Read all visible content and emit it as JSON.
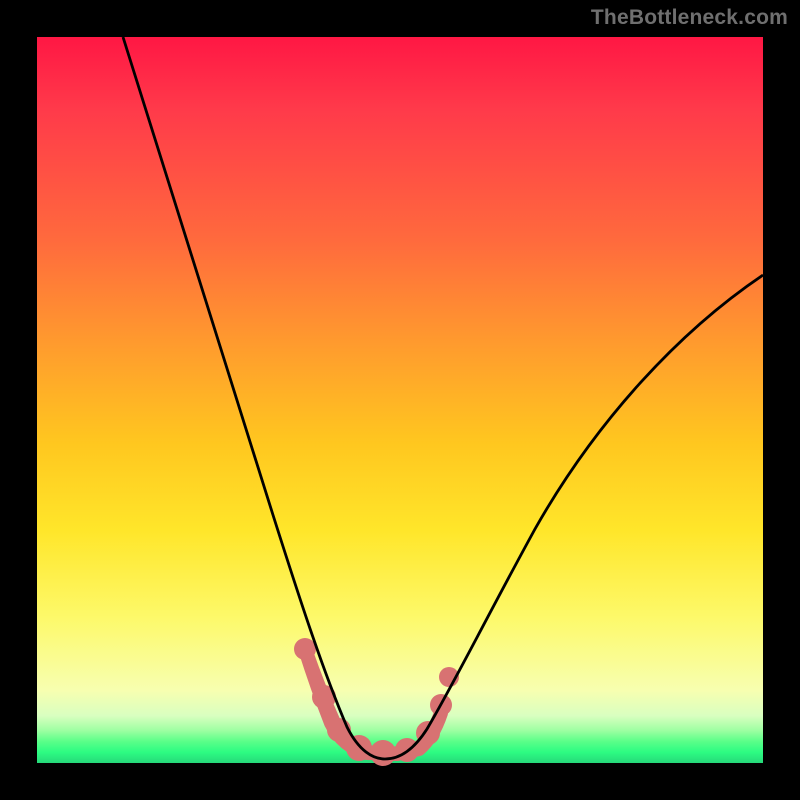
{
  "watermark": "TheBottleneck.com",
  "chart_data": {
    "type": "line",
    "title": "",
    "xlabel": "",
    "ylabel": "",
    "xlim": [
      0,
      100
    ],
    "ylim": [
      0,
      100
    ],
    "grid": false,
    "legend": false,
    "series": [
      {
        "name": "curve",
        "x": [
          12,
          18,
          24,
          30,
          34,
          37,
          39,
          41,
          43,
          45,
          48,
          52,
          55,
          58,
          62,
          68,
          76,
          86,
          98
        ],
        "y": [
          100,
          76,
          56,
          38,
          26,
          17,
          11,
          6,
          3,
          1.5,
          0.8,
          1.5,
          4,
          9,
          17,
          30,
          45,
          58,
          68
        ]
      }
    ],
    "markers": [
      {
        "name": "highlight-dots",
        "x": [
          37,
          40,
          43,
          46,
          49,
          53,
          56
        ],
        "y": [
          16,
          8,
          4,
          2,
          2,
          5,
          12
        ]
      }
    ],
    "gradient_legend": {
      "orientation": "vertical",
      "top": "high",
      "bottom": "low",
      "colors": [
        "#ff1744",
        "#ff9a2e",
        "#ffe62a",
        "#26d97a"
      ]
    }
  }
}
